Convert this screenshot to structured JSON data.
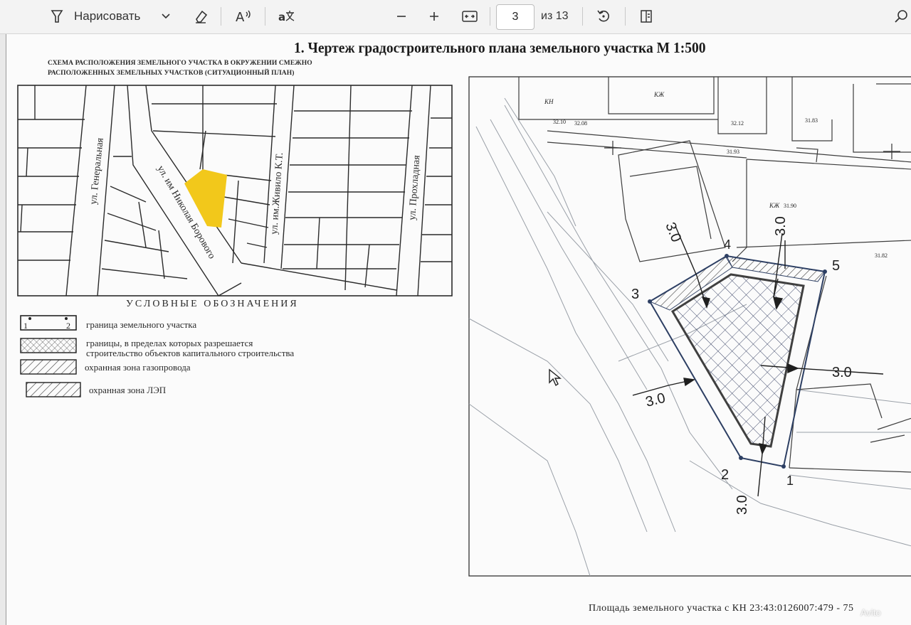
{
  "toolbar": {
    "draw_label": "Нарисовать",
    "page_number": "3",
    "page_total": "из 13"
  },
  "document": {
    "title": "1. Чертеж градостроительного плана земельного участка  М 1:500",
    "scheme_caption_line1": "Схема расположения земельного участка в окружении смежно",
    "scheme_caption_line2": "расположенных земельных участков (ситуационный план)",
    "streets": {
      "generalnaya": "ул. Генеральная",
      "borovogo": "ул. им Николая Борового",
      "zhivilo": "ул. им.Живило К.Т.",
      "prokhladnaya": "ул. Прохладная"
    },
    "legend": {
      "title": "УСЛОВНЫЕ ОБОЗНАЧЕНИЯ",
      "items": [
        {
          "text": "граница земельного участка",
          "n1": "1",
          "n2": "2"
        },
        {
          "text_line1": "границы, в пределах которых разрешается",
          "text_line2": "строительство объектов капитального строительства"
        },
        {
          "text": "охранная зона газопровода"
        },
        {
          "text": "охранная зона ЛЭП"
        }
      ]
    },
    "plan": {
      "points": [
        "1",
        "2",
        "3",
        "4",
        "5"
      ],
      "setback": "3.0",
      "kzh": "КЖ",
      "kn": "КН",
      "elev": [
        "32.10",
        "32.08",
        "31.93",
        "31.90",
        "31.82",
        "31.83",
        "32.12"
      ]
    },
    "footer": "Площадь  земельного  участка с КН 23:43:0126007:479 - 75",
    "watermark": "Avito"
  },
  "colors": {
    "highlight": "#f2c81b",
    "plan_blue": "#2d3f63",
    "ink": "#1f1f1f"
  }
}
